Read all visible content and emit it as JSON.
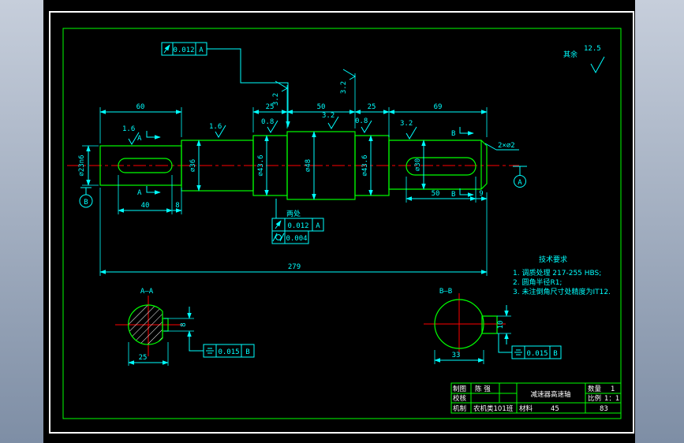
{
  "drawing": {
    "surface_note": {
      "prefix": "其余",
      "value": "12.5"
    },
    "dims": {
      "top": [
        "60",
        "25",
        "50",
        "25",
        "69"
      ],
      "diameters": [
        "∅23n6",
        "∅36",
        "∅43.6",
        "∅48",
        "∅43.6",
        "∅30"
      ],
      "bottom": [
        "40",
        "8",
        "50",
        "9",
        "279"
      ]
    },
    "roughness": {
      "values": [
        "1.6",
        "1.6",
        "0.8",
        "3.2",
        "3.2",
        "3.2",
        "0.8",
        "3.2"
      ]
    },
    "fcf": {
      "top": {
        "symbol": "circular-runout",
        "tolerance": "0.012",
        "datum": "A"
      },
      "mid": {
        "label": "两处",
        "row1": {
          "symbol": "circular-runout",
          "tolerance": "0.012",
          "datum": "A"
        },
        "row2": {
          "symbol": "cylindricity",
          "tolerance": "0.004"
        }
      },
      "section_a": {
        "symbol": "symmetry",
        "tolerance": "0.015",
        "datum": "B"
      },
      "section_b": {
        "symbol": "symmetry",
        "tolerance": "0.015",
        "datum": "B"
      }
    },
    "sections": {
      "a": {
        "title": "A—A",
        "mark": "A",
        "width": "25",
        "keyway": "8"
      },
      "b": {
        "title": "B—B",
        "mark": "B",
        "width": "33",
        "keyway": "10"
      }
    },
    "datums": {
      "left": "B",
      "right": "A"
    },
    "chamfer_note": "2×∅2",
    "tech_requirements": {
      "title": "技术要求",
      "items": [
        "1. 调质处理  217-255 HBS;",
        "2. 圆角半径R1;",
        "3. 未注倒角尺寸处精度为IT12."
      ]
    },
    "title_block": {
      "drawn_label": "制图",
      "drawn_by": "陈 强",
      "checked_label": "校核",
      "dept_label": "机制",
      "dept": "农机类101班",
      "material_label": "材料",
      "material": "45",
      "title": "减速器高速轴",
      "qty_label": "数量",
      "qty": "1",
      "scale_label": "比例",
      "scale": "1：1",
      "sheet": "83"
    },
    "colors": {
      "geometry": "#00ff00",
      "dimension": "#00ffff",
      "centerline": "#ff0000",
      "frame": "#ffffff",
      "background": "#000000"
    },
    "icons": {
      "runout": "circular-runout-icon",
      "cylindricity": "cylindricity-icon",
      "symmetry": "symmetry-icon",
      "roughness": "roughness-check-icon",
      "datum": "datum-circle-icon"
    }
  }
}
